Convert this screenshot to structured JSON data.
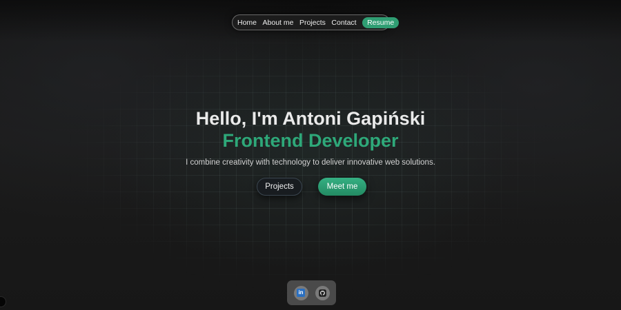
{
  "nav": {
    "items": [
      "Home",
      "About me",
      "Projects",
      "Contact"
    ],
    "resume_label": "Resume"
  },
  "hero": {
    "title": "Hello, I'm Antoni Gapiński",
    "role": "Frontend Developer",
    "tagline": "I combine creativity with technology to deliver innovative web solutions.",
    "projects_label": "Projects",
    "meet_label": "Meet me"
  },
  "social": {
    "linkedin_icon": "linkedin-icon",
    "linkedin_text": "in",
    "github_icon": "github-icon"
  },
  "colors": {
    "accent": "#2ea879",
    "background": "#161616"
  }
}
